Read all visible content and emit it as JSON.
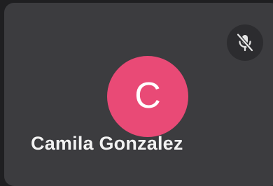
{
  "participant": {
    "name": "Camila Gonzalez",
    "initial": "C",
    "avatar_color": "#e94a76",
    "mic_state": "muted",
    "mic_icon": "mic-off-icon"
  },
  "colors": {
    "tile_background": "#3c3c3f",
    "page_background": "#1f1f21",
    "badge_background": "#2c2c2f"
  }
}
